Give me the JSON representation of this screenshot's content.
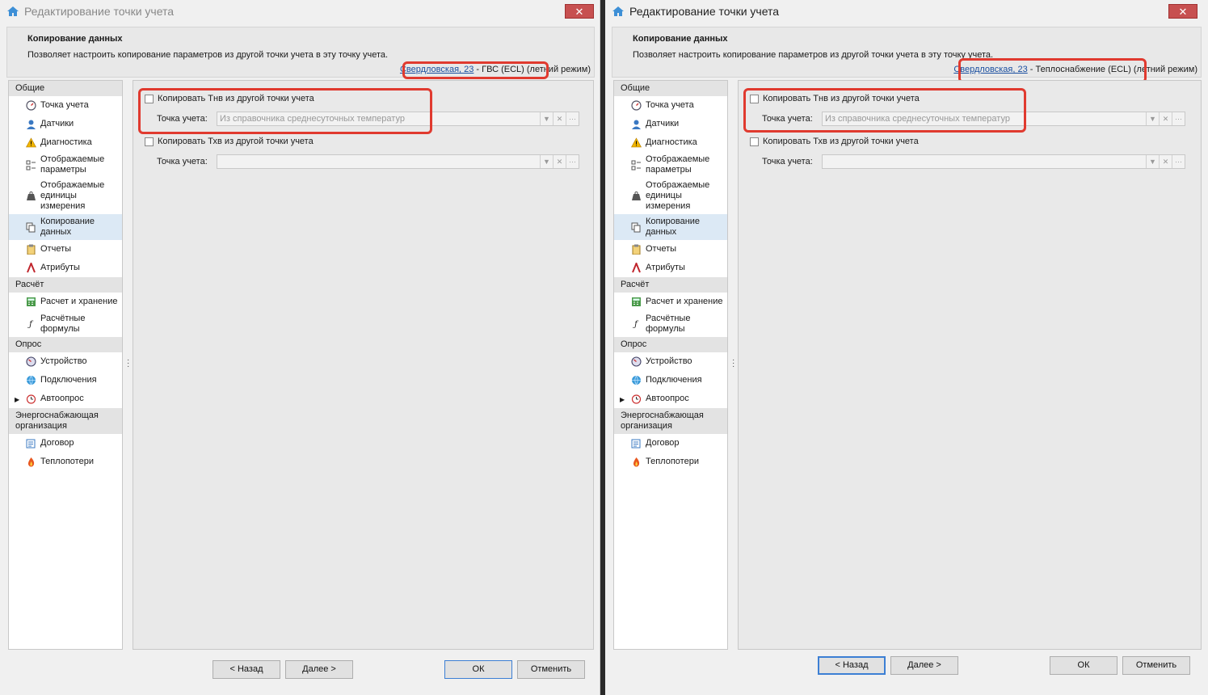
{
  "dialog": {
    "title": "Редактирование точки учета",
    "close_glyph": "✕",
    "header_title": "Копирование данных",
    "header_desc": "Позволяет настроить копирование параметров из другой точки учета в эту точку учета."
  },
  "left": {
    "link": "Свердловская, 23",
    "link_suffix": " - ГВС (ECL) (летний режим)"
  },
  "right": {
    "link": "Свердловская, 23",
    "link_suffix": " - Теплоснабжение (ECL) (летний режим)"
  },
  "sidebar": {
    "s1": "Общие",
    "i1": "Точка учета",
    "i2": "Датчики",
    "i3": "Диагностика",
    "i4": "Отображаемые параметры",
    "i5": "Отображаемые единицы измерения",
    "i6": "Копирование данных",
    "i7": "Отчеты",
    "i8": "Атрибуты",
    "s2": "Расчёт",
    "i9": "Расчет и хранение",
    "i10": "Расчётные формулы",
    "s3": "Опрос",
    "i11": "Устройство",
    "i12": "Подключения",
    "i13": "Автоопрос",
    "s4": "Энергоснабжающая организация",
    "i14": "Договор",
    "i15": "Теплопотери"
  },
  "form": {
    "copy_tnv": "Копировать Тнв из другой точки учета",
    "point_label": "Точка учета:",
    "point_placeholder": "Из справочника среднесуточных температур",
    "copy_txv": "Копировать Тхв из другой точки учета",
    "point_label2": "Точка учета:",
    "point_value2": ""
  },
  "buttons": {
    "back": "< Назад",
    "next": "Далее >",
    "ok": "ОК",
    "cancel": "Отменить"
  },
  "colors": {
    "highlight": "#e03a2f",
    "link": "#1a4fa0",
    "selected_bg": "#dce9f5"
  }
}
